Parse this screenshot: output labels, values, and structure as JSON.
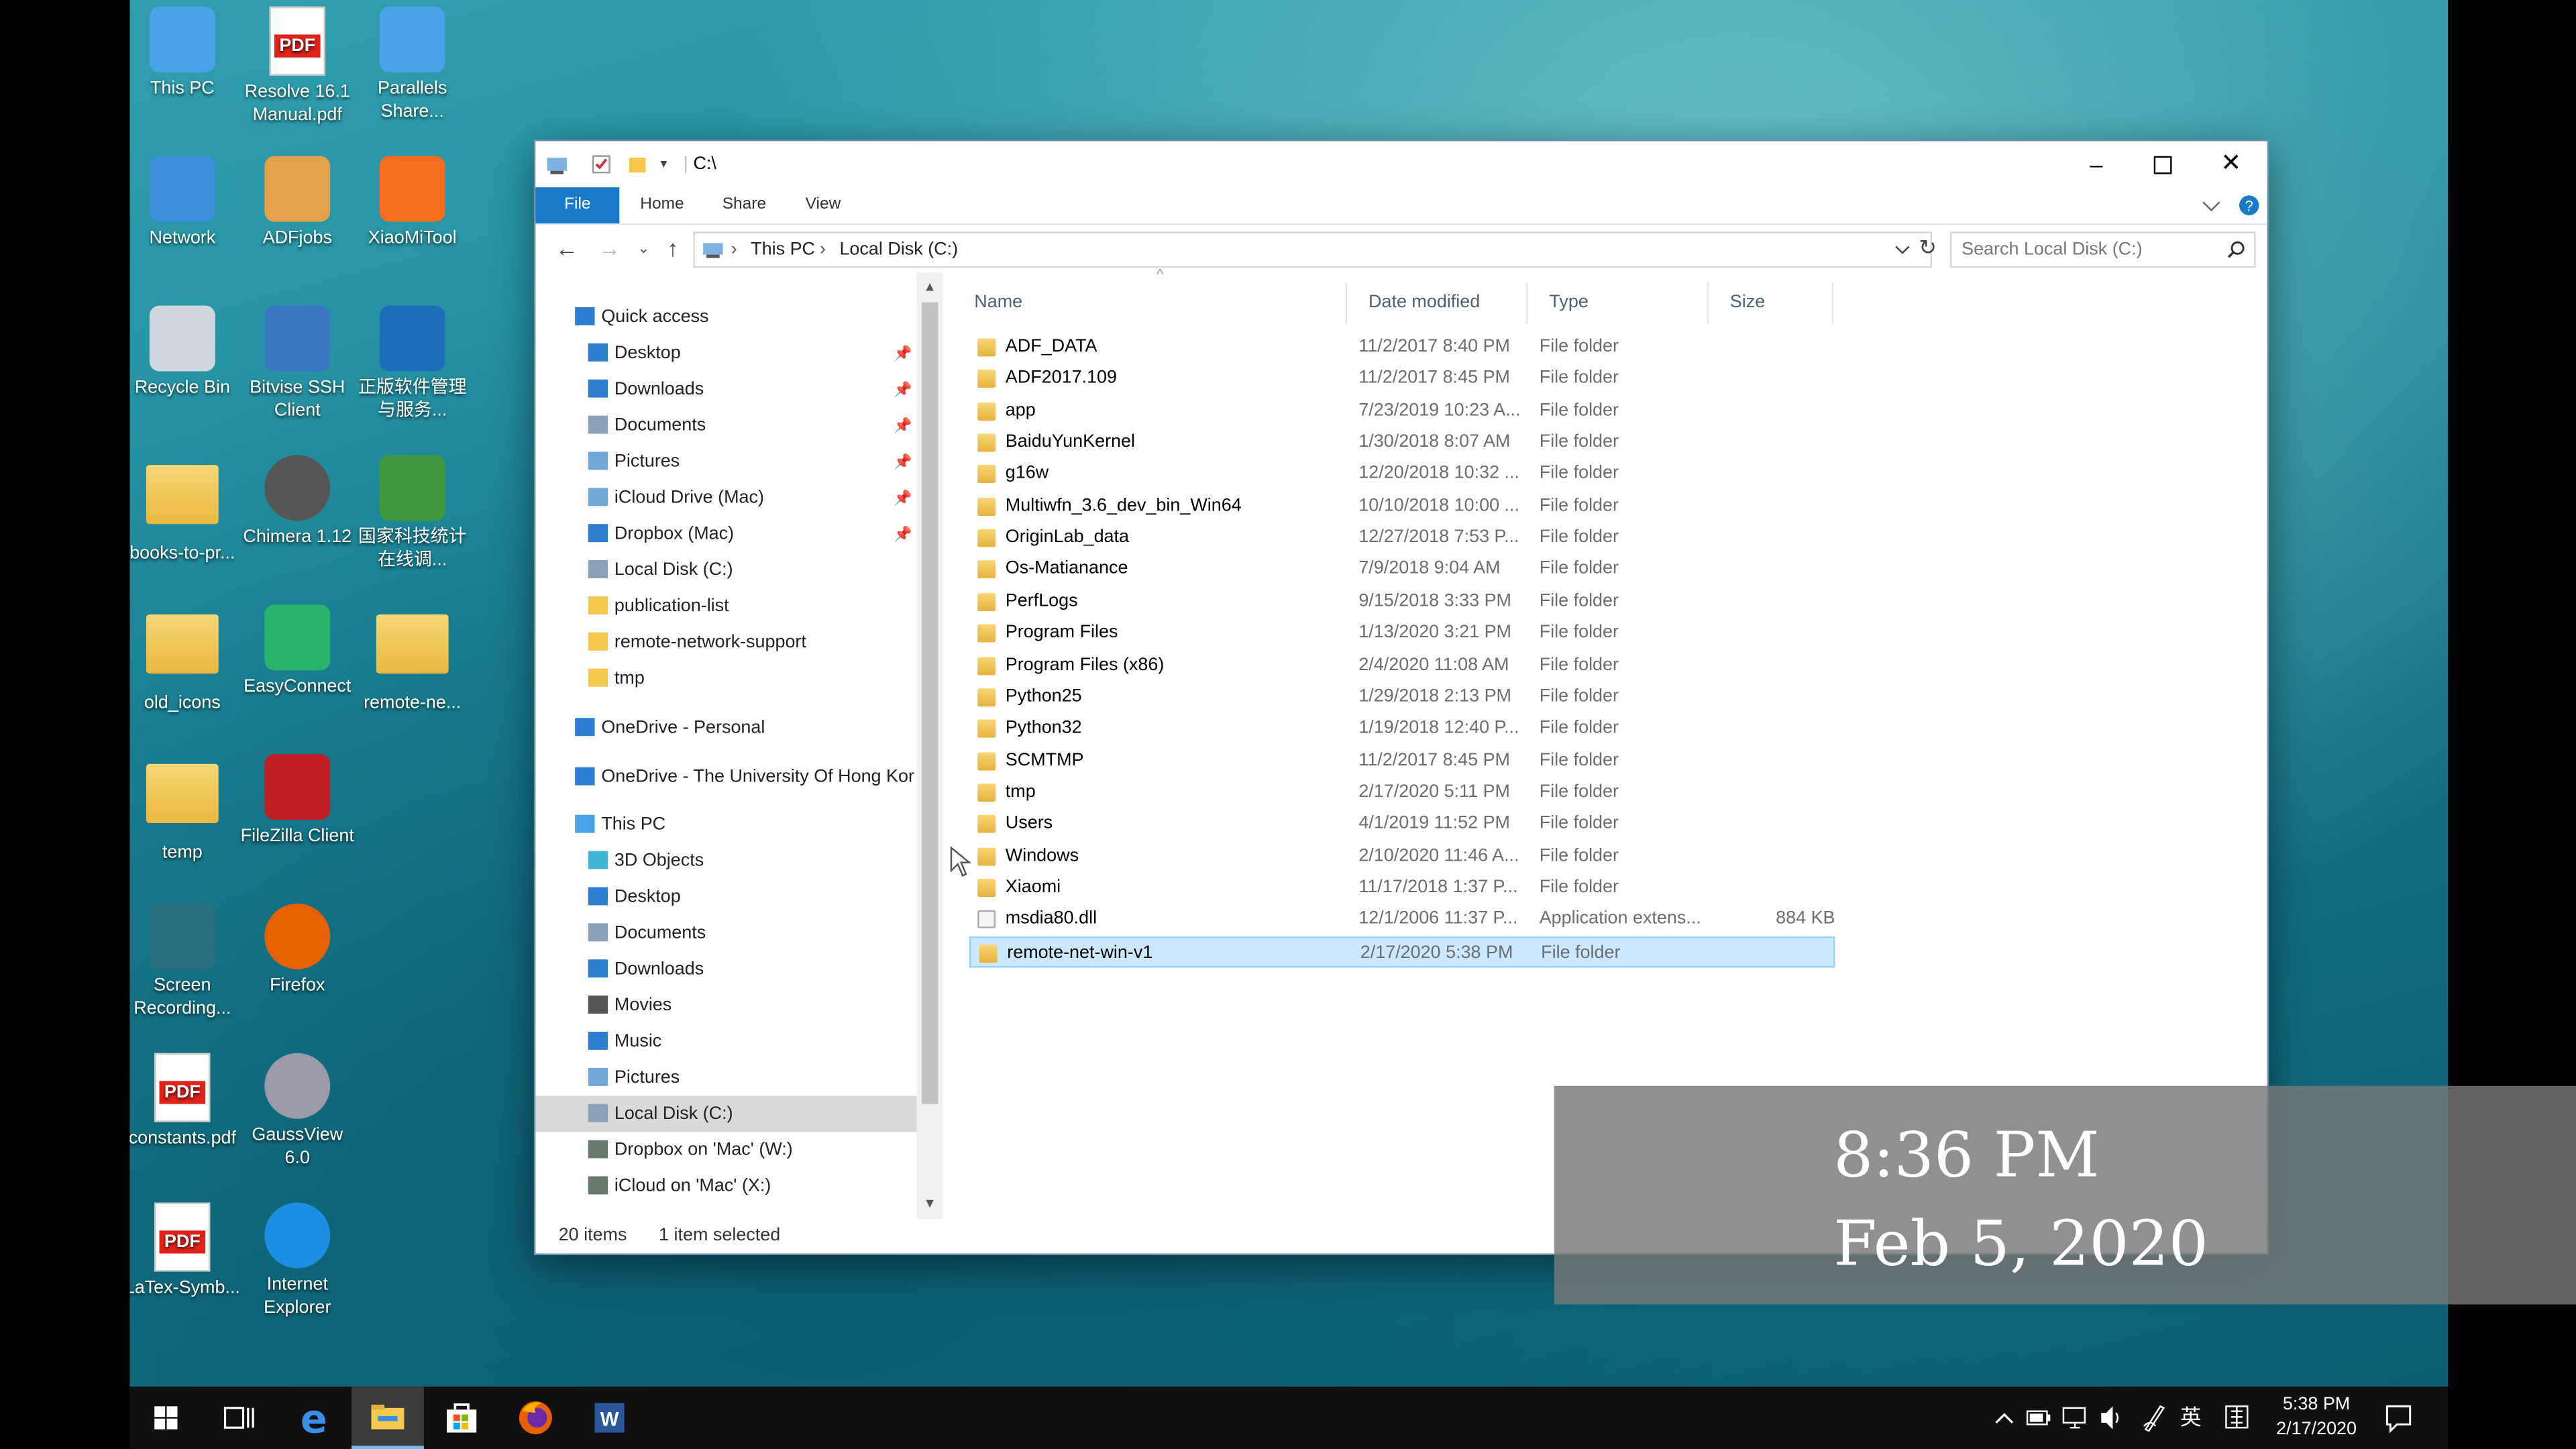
{
  "desktop_icons": [
    {
      "label": "This PC",
      "icon": "pc-icon"
    },
    {
      "label": "Resolve 16.1 Manual.pdf",
      "icon": "pdf-icon"
    },
    {
      "label": "Parallels Share...",
      "icon": "parallels-share-icon"
    },
    {
      "label": "Network",
      "icon": "network-icon"
    },
    {
      "label": "ADFjobs",
      "icon": "adfjobs-icon"
    },
    {
      "label": "XiaoMiTool",
      "icon": "xiaomitool-icon"
    },
    {
      "label": "Recycle Bin",
      "icon": "recycle-bin-icon"
    },
    {
      "label": "Bitvise SSH Client",
      "icon": "bitvise-ssh-icon"
    },
    {
      "label": "正版软件管理与服务...",
      "icon": "software-management-icon"
    },
    {
      "label": "books-to-pr...",
      "icon": "folder-books-icon"
    },
    {
      "label": "Chimera 1.12",
      "icon": "chimera-icon"
    },
    {
      "label": "国家科技统计在线调...",
      "icon": "sts-icon"
    },
    {
      "label": "old_icons",
      "icon": "folder-old-icons-icon"
    },
    {
      "label": "EasyConnect",
      "icon": "easyconnect-icon"
    },
    {
      "label": "remote-ne...",
      "icon": "folder-remote-icon"
    },
    {
      "label": "temp",
      "icon": "folder-temp-icon"
    },
    {
      "label": "FileZilla Client",
      "icon": "filezilla-icon"
    },
    {
      "label": "Screen Recording...",
      "icon": "screen-recording-icon"
    },
    {
      "label": "Firefox",
      "icon": "firefox-icon"
    },
    {
      "label": "constants.pdf",
      "icon": "pdf-icon"
    },
    {
      "label": "GaussView 6.0",
      "icon": "gaussview-icon"
    },
    {
      "label": "LaTex-Symb...",
      "icon": "pdf-icon"
    },
    {
      "label": "Internet Explorer",
      "icon": "internet-explorer-icon"
    }
  ],
  "window": {
    "title": "C:\\",
    "ribbon_tabs": [
      "File",
      "Home",
      "Share",
      "View"
    ],
    "breadcrumb": [
      "This PC",
      "Local Disk (C:)"
    ],
    "search_placeholder": "Search Local Disk (C:)"
  },
  "nav": {
    "quick_access": "Quick access",
    "quick_items": [
      {
        "label": "Desktop",
        "pinned": true
      },
      {
        "label": "Downloads",
        "pinned": true
      },
      {
        "label": "Documents",
        "pinned": true
      },
      {
        "label": "Pictures",
        "pinned": true
      },
      {
        "label": "iCloud Drive (Mac)",
        "pinned": true
      },
      {
        "label": "Dropbox (Mac)",
        "pinned": true
      },
      {
        "label": "Local Disk (C:)",
        "pinned": false
      },
      {
        "label": "publication-list",
        "pinned": false
      },
      {
        "label": "remote-network-support",
        "pinned": false
      },
      {
        "label": "tmp",
        "pinned": false
      }
    ],
    "onedrive_personal": "OneDrive - Personal",
    "onedrive_hku": "OneDrive - The University Of Hong Kor",
    "this_pc": "This PC",
    "pc_items": [
      "3D Objects",
      "Desktop",
      "Documents",
      "Downloads",
      "Movies",
      "Music",
      "Pictures",
      "Local Disk (C:)",
      "Dropbox on 'Mac' (W:)",
      "iCloud on 'Mac' (X:)"
    ]
  },
  "columns": [
    "Name",
    "Date modified",
    "Type",
    "Size"
  ],
  "files": [
    {
      "name": "ADF_DATA",
      "date": "11/2/2017 8:40 PM",
      "type": "File folder",
      "size": ""
    },
    {
      "name": "ADF2017.109",
      "date": "11/2/2017 8:45 PM",
      "type": "File folder",
      "size": ""
    },
    {
      "name": "app",
      "date": "7/23/2019 10:23 A...",
      "type": "File folder",
      "size": ""
    },
    {
      "name": "BaiduYunKernel",
      "date": "1/30/2018 8:07 AM",
      "type": "File folder",
      "size": ""
    },
    {
      "name": "g16w",
      "date": "12/20/2018 10:32 ...",
      "type": "File folder",
      "size": ""
    },
    {
      "name": "Multiwfn_3.6_dev_bin_Win64",
      "date": "10/10/2018 10:00 ...",
      "type": "File folder",
      "size": ""
    },
    {
      "name": "OriginLab_data",
      "date": "12/27/2018 7:53 P...",
      "type": "File folder",
      "size": ""
    },
    {
      "name": "Os-Matianance",
      "date": "7/9/2018 9:04 AM",
      "type": "File folder",
      "size": ""
    },
    {
      "name": "PerfLogs",
      "date": "9/15/2018 3:33 PM",
      "type": "File folder",
      "size": ""
    },
    {
      "name": "Program Files",
      "date": "1/13/2020 3:21 PM",
      "type": "File folder",
      "size": ""
    },
    {
      "name": "Program Files (x86)",
      "date": "2/4/2020 11:08 AM",
      "type": "File folder",
      "size": ""
    },
    {
      "name": "Python25",
      "date": "1/29/2018 2:13 PM",
      "type": "File folder",
      "size": ""
    },
    {
      "name": "Python32",
      "date": "1/19/2018 12:40 P...",
      "type": "File folder",
      "size": ""
    },
    {
      "name": "SCMTMP",
      "date": "11/2/2017 8:45 PM",
      "type": "File folder",
      "size": ""
    },
    {
      "name": "tmp",
      "date": "2/17/2020 5:11 PM",
      "type": "File folder",
      "size": ""
    },
    {
      "name": "Users",
      "date": "4/1/2019 11:52 PM",
      "type": "File folder",
      "size": ""
    },
    {
      "name": "Windows",
      "date": "2/10/2020 11:46 A...",
      "type": "File folder",
      "size": ""
    },
    {
      "name": "Xiaomi",
      "date": "11/17/2018 1:37 P...",
      "type": "File folder",
      "size": ""
    },
    {
      "name": "msdia80.dll",
      "date": "12/1/2006 11:37 P...",
      "type": "Application extens...",
      "size": "884 KB"
    },
    {
      "name": "remote-net-win-v1",
      "date": "2/17/2020 5:38 PM",
      "type": "File folder",
      "size": ""
    }
  ],
  "status": {
    "count": "20 items",
    "selected": "1 item selected"
  },
  "overlay": {
    "time": "8:36 PM",
    "date": "Feb 5, 2020"
  },
  "taskbar": {
    "time": "5:38 PM",
    "date": "2/17/2020",
    "ime": "英",
    "apps": [
      "start-icon",
      "task-view-icon",
      "edge-icon",
      "file-explorer-icon",
      "store-icon",
      "firefox-icon",
      "word-icon"
    ]
  }
}
